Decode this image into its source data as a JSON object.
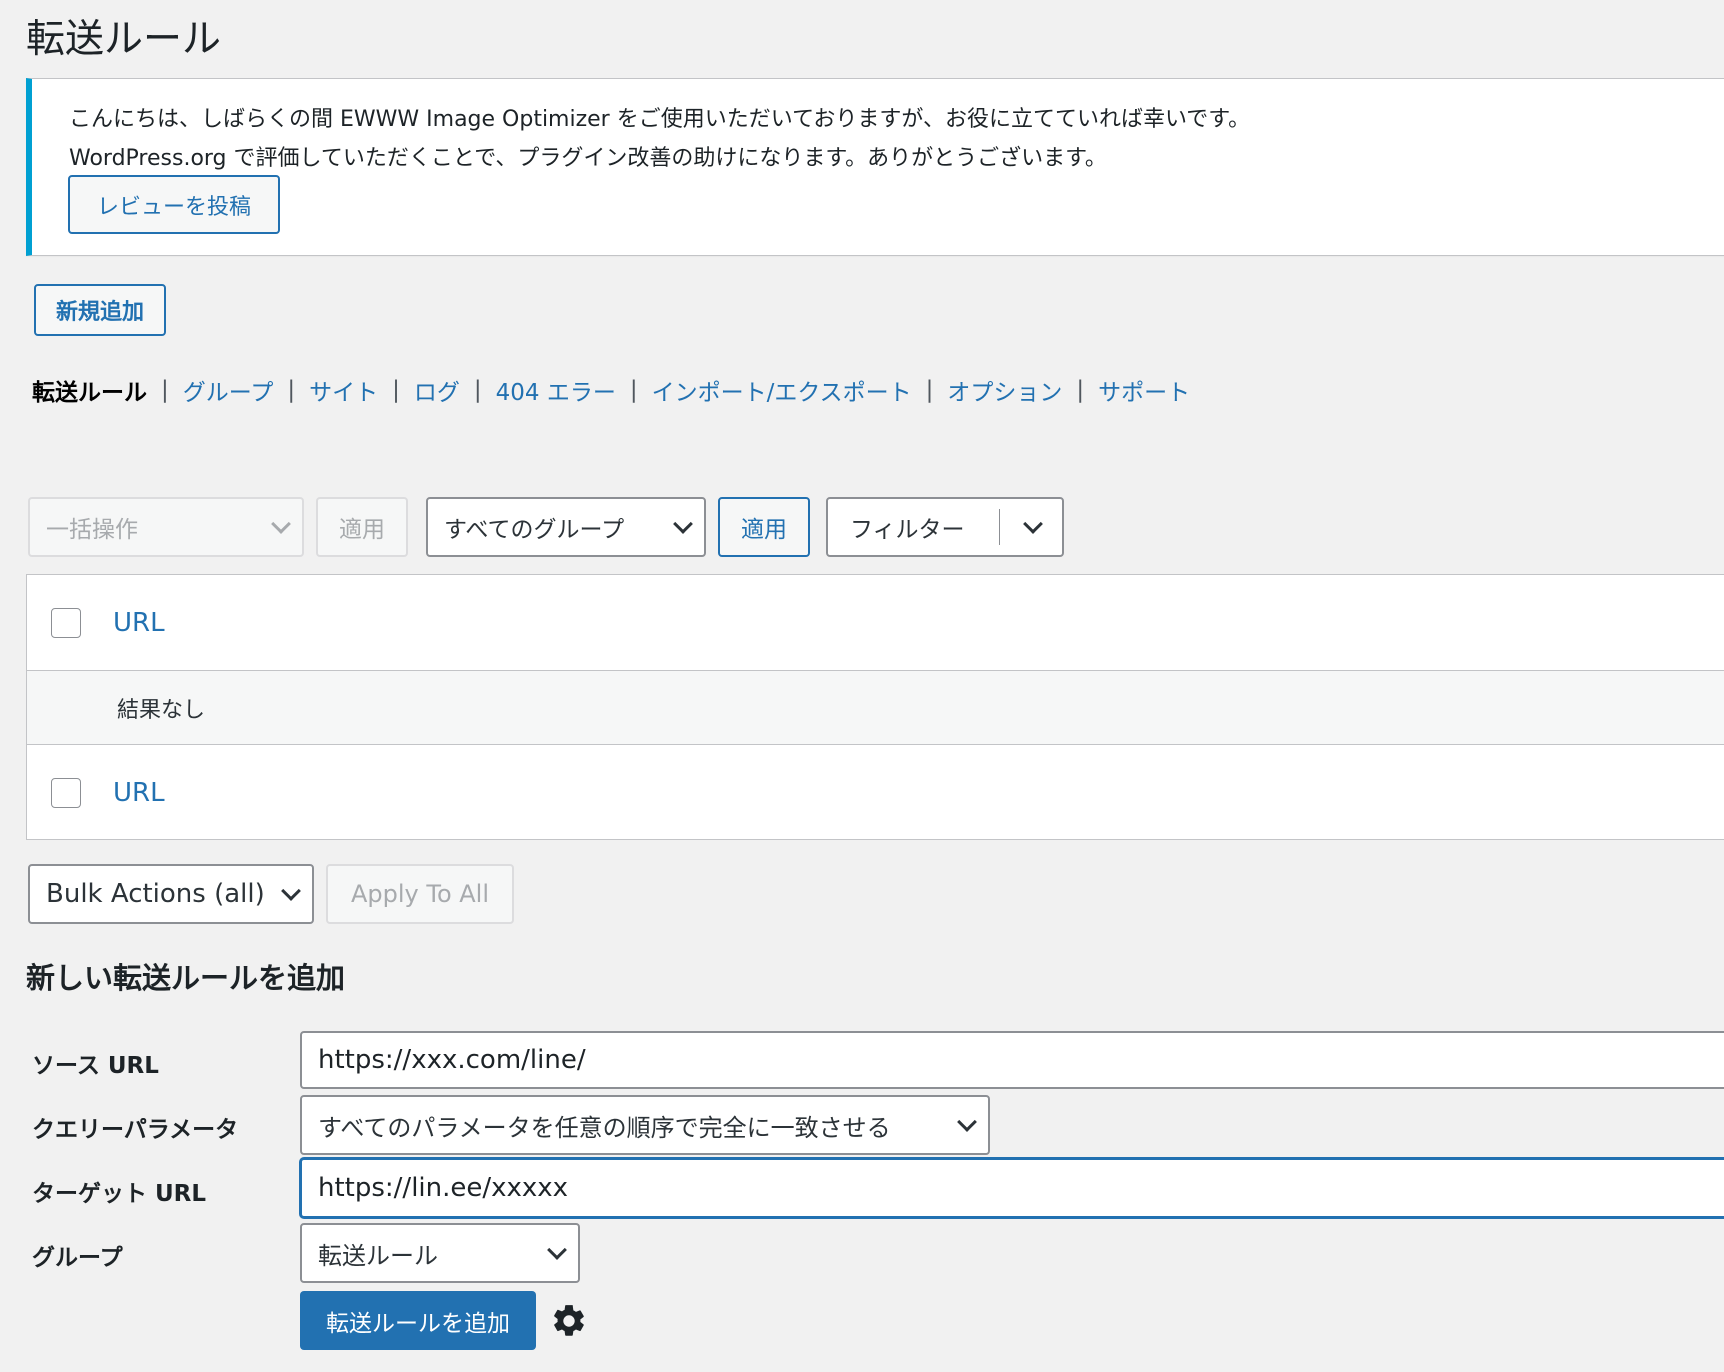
{
  "header": {
    "title": "転送ルール"
  },
  "notice": {
    "line1": "こんにちは、しばらくの間 EWWW Image Optimizer をご使用いただいておりますが、お役に立てていれば幸いです。",
    "line2": "WordPress.org で評価していただくことで、プラグイン改善の助けになります。ありがとうございます。",
    "review_button": "レビューを投稿",
    "accent_color": "#00a0d2"
  },
  "actions": {
    "add_new": "新規追加"
  },
  "subnav": {
    "current": "転送ルール",
    "items": [
      "グループ",
      "サイト",
      "ログ",
      "404 エラー",
      "インポート/エクスポート",
      "オプション",
      "サポート"
    ],
    "separator": "|"
  },
  "toolbar": {
    "bulk_select": "一括操作",
    "bulk_apply": "適用",
    "group_select": "すべてのグループ",
    "group_apply": "適用",
    "filter_label": "フィルター"
  },
  "table": {
    "column_url": "URL",
    "empty_message": "結果なし"
  },
  "bottom_toolbar": {
    "bulk_all": "Bulk Actions (all)",
    "apply_all": "Apply To All"
  },
  "add_form": {
    "title": "新しい転送ルールを追加",
    "source_label": "ソース URL",
    "source_value": "https://xxx.com/line/",
    "query_label": "クエリーパラメータ",
    "query_value": "すべてのパラメータを任意の順序で完全に一致させる",
    "target_label": "ターゲット URL",
    "target_value": "https://lin.ee/xxxxx",
    "group_label": "グループ",
    "group_value": "転送ルール",
    "submit": "転送ルールを追加",
    "settings_icon": "gear-icon"
  },
  "colors": {
    "primary": "#2271b1",
    "background": "#f1f1f1"
  }
}
